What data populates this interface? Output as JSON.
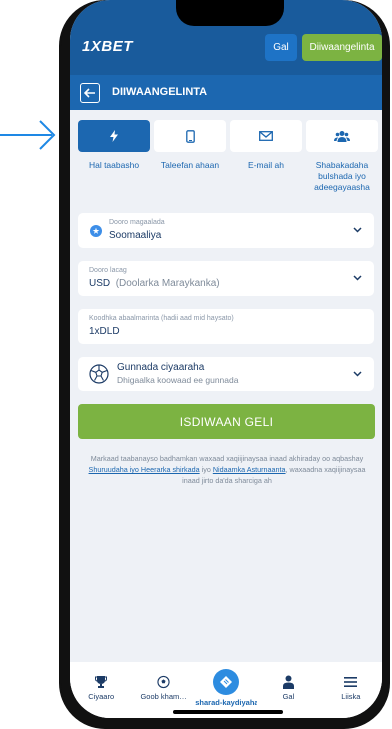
{
  "header": {
    "logo_prefix": "1X",
    "logo_suffix": "BET",
    "login_label": "Gal",
    "register_label": "Diiwaangelinta"
  },
  "subheader": {
    "title": "DIIWAANGELINTA"
  },
  "tabs": [
    {
      "label": "Hal taabasho",
      "icon": "lightning-icon",
      "active": true
    },
    {
      "label": "Taleefan ahaan",
      "icon": "phone-icon",
      "active": false
    },
    {
      "label": "E-mail ah",
      "icon": "envelope-icon",
      "active": false
    },
    {
      "label": "Shabakadaha bulshada iyo adeegayaasha",
      "icon": "people-icon",
      "active": false
    }
  ],
  "country": {
    "label": "Dooro magaalada",
    "value": "Soomaaliya"
  },
  "currency": {
    "label": "Dooro lacag",
    "code": "USD",
    "name": "(Doolarka Maraykanka)"
  },
  "promo": {
    "label": "Koodhka abaalmarinta (hadii aad mid haysato)",
    "value": "1xDLD"
  },
  "bonus": {
    "title": "Gunnada ciyaaraha",
    "subtitle": "Dhigaalka koowaad ee gunnada"
  },
  "cta_label": "ISDIWAAN GELI",
  "terms": {
    "part1": "Markaad taabanayso badhamkan waxaad xaqiijinaysaa inaad akhiraday oo aqbashay ",
    "link1": "Shuruudaha iyo Heerarka shirkada",
    "part2": " iyo ",
    "link2": "Nidaamka Asturnaanta",
    "part3": ", waxaadna xaqiijinaysaa inaad jirto da'da sharciga ah"
  },
  "bottom_nav": [
    {
      "label": "Ciyaaro",
      "icon": "trophy-icon"
    },
    {
      "label": "Goob kham…",
      "icon": "soccer-ball-icon"
    },
    {
      "label": "'sharad-kaydiyaha",
      "icon": "ticket-icon"
    },
    {
      "label": "Gal",
      "icon": "user-icon"
    },
    {
      "label": "Liiska",
      "icon": "menu-icon"
    }
  ],
  "colors": {
    "brand_blue": "#195b9c",
    "accent_green": "#7cb342",
    "link_blue": "#1c67b0"
  }
}
